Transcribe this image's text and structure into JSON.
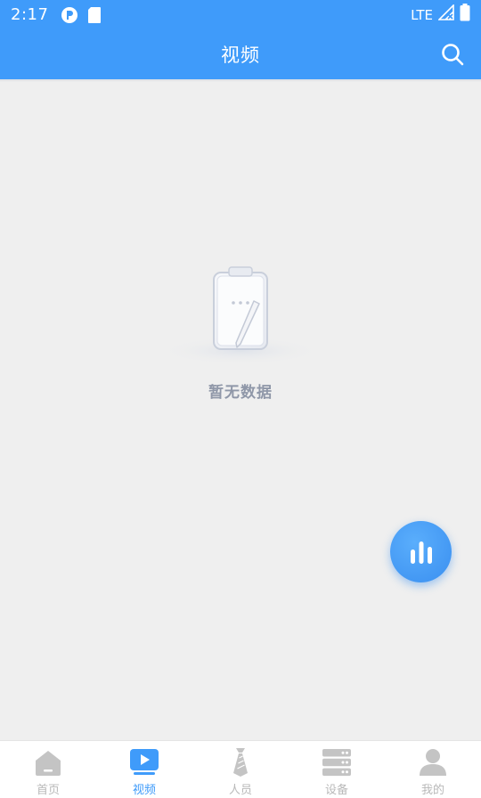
{
  "status_bar": {
    "time": "2:17",
    "network": "LTE"
  },
  "header": {
    "title": "视频",
    "search_icon": "search-icon"
  },
  "empty_state": {
    "icon": "clipboard-icon",
    "text": "暂无数据"
  },
  "fab": {
    "icon": "bar-chart-icon"
  },
  "bottom_nav": {
    "items": [
      {
        "label": "首页",
        "icon": "home-icon",
        "active": false
      },
      {
        "label": "视频",
        "icon": "video-icon",
        "active": true
      },
      {
        "label": "人员",
        "icon": "person-tie-icon",
        "active": false
      },
      {
        "label": "设备",
        "icon": "server-icon",
        "active": false
      },
      {
        "label": "我的",
        "icon": "user-icon",
        "active": false
      }
    ]
  },
  "colors": {
    "primary": "#3f9bfa",
    "background": "#efefef",
    "inactive": "#b9b9b9",
    "empty_text": "#8f97a8"
  }
}
